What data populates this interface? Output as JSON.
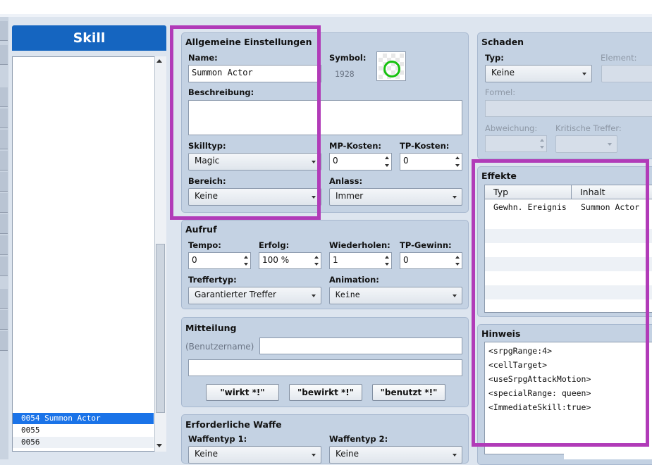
{
  "skill_list": {
    "header": "Skill",
    "rows": [
      {
        "label": "0054 Summon Actor",
        "selected": true
      },
      {
        "label": "0055",
        "selected": false
      },
      {
        "label": "0056",
        "selected": false
      }
    ]
  },
  "general": {
    "title": "Allgemeine Einstellungen",
    "name_label": "Name:",
    "name_value": "Summon Actor",
    "symbol_label": "Symbol:",
    "symbol_index": "1928",
    "description_label": "Beschreibung:",
    "description_value": "",
    "skill_type_label": "Skilltyp:",
    "skill_type_value": "Magic",
    "mp_cost_label": "MP-Kosten:",
    "mp_cost_value": "0",
    "tp_cost_label": "TP-Kosten:",
    "tp_cost_value": "0",
    "scope_label": "Bereich:",
    "scope_value": "Keine",
    "occasion_label": "Anlass:",
    "occasion_value": "Immer"
  },
  "invocation": {
    "title": "Aufruf",
    "speed_label": "Tempo:",
    "speed_value": "0",
    "success_label": "Erfolg:",
    "success_value": "100 %",
    "repeat_label": "Wiederholen:",
    "repeat_value": "1",
    "tp_gain_label": "TP-Gewinn:",
    "tp_gain_value": "0",
    "hit_type_label": "Treffertyp:",
    "hit_type_value": "Garantierter Treffer",
    "animation_label": "Animation:",
    "animation_value": "Keine"
  },
  "message": {
    "title": "Mitteilung",
    "user_name_placeholder": "(Benutzername)",
    "line1": "",
    "line2": "",
    "buttons": [
      "\"wirkt *!\"",
      "\"bewirkt *!\"",
      "\"benutzt *!\""
    ]
  },
  "weapon": {
    "title": "Erforderliche Waffe",
    "type1_label": "Waffentyp 1:",
    "type1_value": "Keine",
    "type2_label": "Waffentyp 2:",
    "type2_value": "Keine"
  },
  "damage": {
    "title": "Schaden",
    "type_label": "Typ:",
    "type_value": "Keine",
    "element_label": "Element:",
    "formula_label": "Formel:",
    "variance_label": "Abweichung:",
    "critical_label": "Kritische Treffer:"
  },
  "effects": {
    "title": "Effekte",
    "columns": [
      "Typ",
      "Inhalt"
    ],
    "rows": [
      {
        "type": "Gewhn. Ereignis",
        "content": "Summon Actor"
      }
    ]
  },
  "note": {
    "title": "Hinweis",
    "lines": [
      "<srpgRange:4>",
      "<cellTarget>",
      "<useSrpgAttackMotion>",
      "<specialRange: queen>",
      "<ImmediateSkill:true>"
    ]
  },
  "colors": {
    "accent": "#1565c0",
    "highlight_frame": "#b13bb8",
    "panel": "#c4d2e3"
  },
  "icons": {
    "symbol_preview": "green-ring-icon"
  }
}
